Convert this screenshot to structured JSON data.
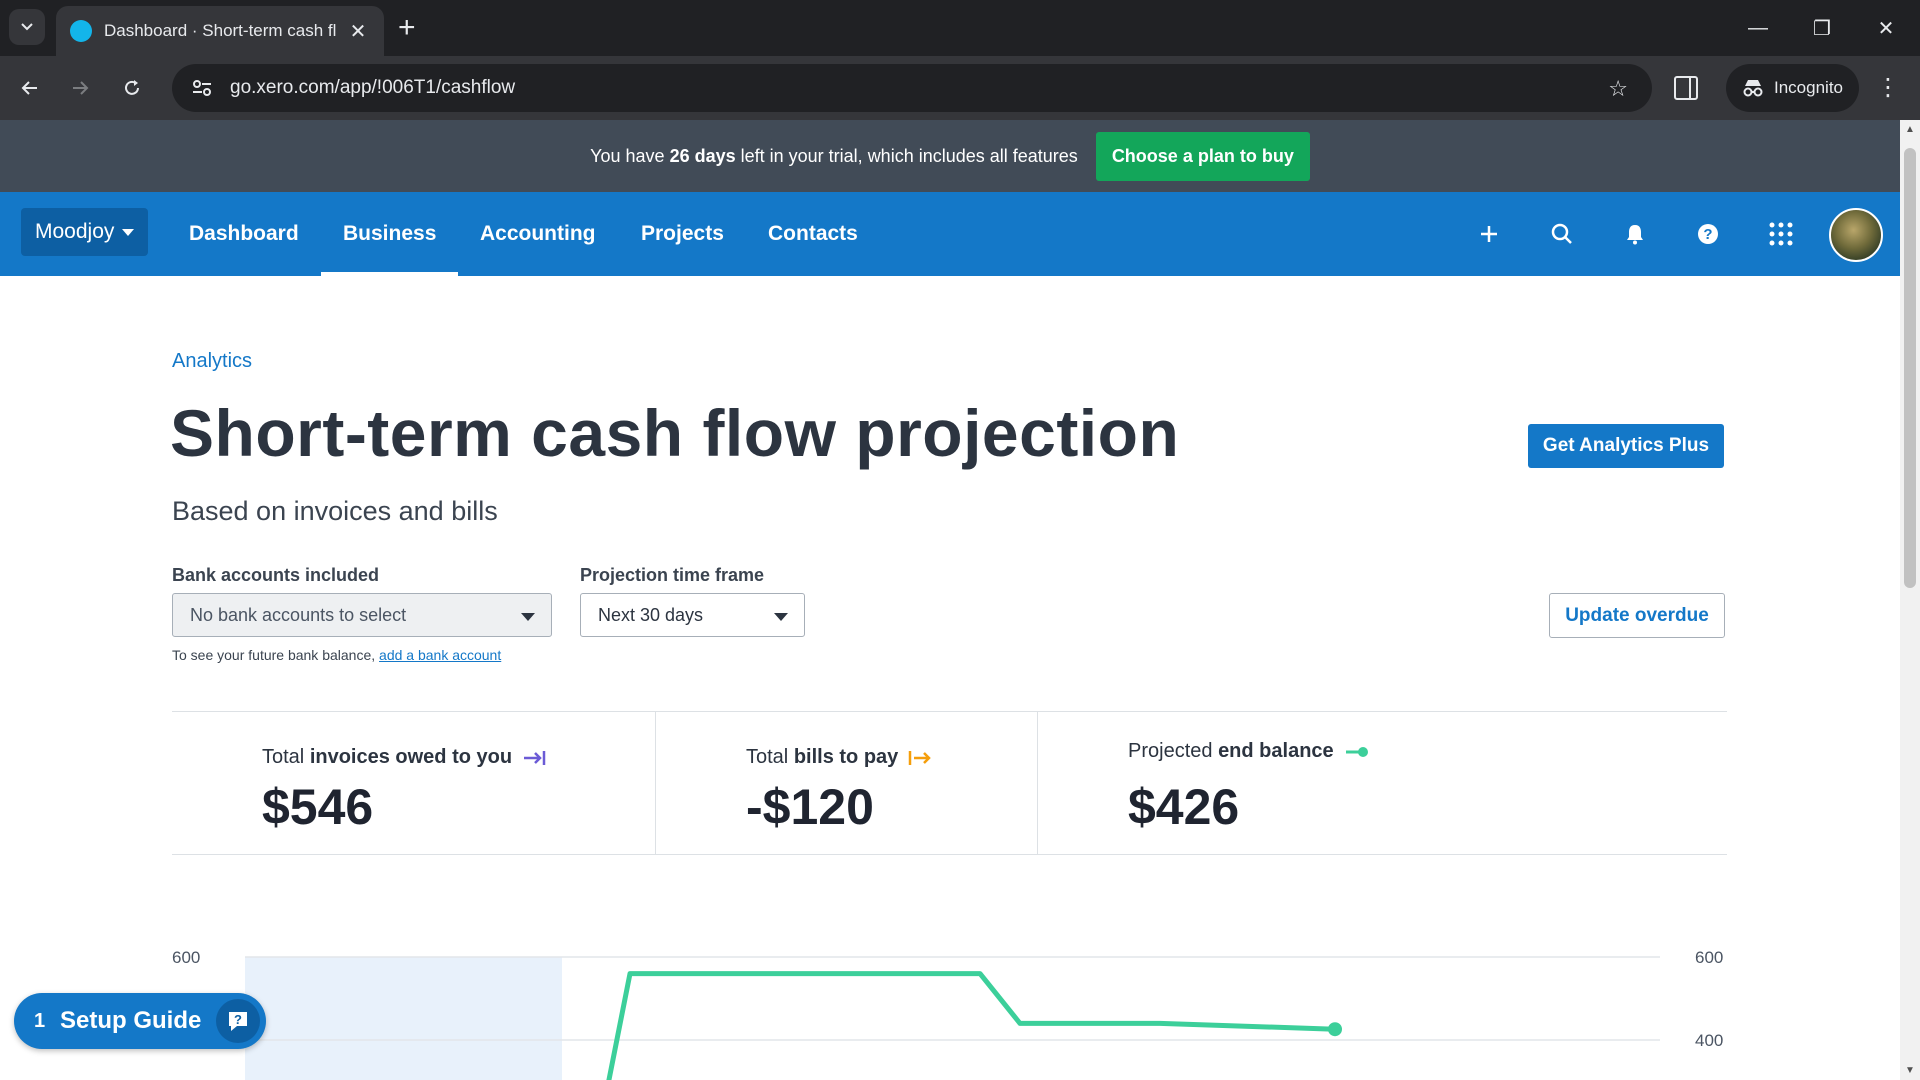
{
  "browser": {
    "tab_title": "Dashboard · Short-term cash fl",
    "url": "go.xero.com/app/!006T1/cashflow",
    "incognito_label": "Incognito",
    "new_tab": "+",
    "close_tab": "✕",
    "minimize": "—",
    "maximize": "❐",
    "close_window": "✕"
  },
  "trial_banner": {
    "text_before": "You have ",
    "days": "26 days",
    "text_after": " left in your trial, which includes all features",
    "cta": "Choose a plan to buy"
  },
  "nav": {
    "org": "Moodjoy",
    "items": [
      "Dashboard",
      "Business",
      "Accounting",
      "Projects",
      "Contacts"
    ],
    "active": "Business"
  },
  "page": {
    "breadcrumb": "Analytics",
    "title": "Short-term cash flow projection",
    "subtitle": "Based on invoices and bills",
    "cta": "Get Analytics Plus"
  },
  "filters": {
    "bank_label": "Bank accounts included",
    "bank_value": "No bank accounts to select",
    "timeframe_label": "Projection time frame",
    "timeframe_value": "Next 30 days",
    "hint_text": "To see your future bank balance, ",
    "hint_link": "add a bank account",
    "update_button": "Update overdue"
  },
  "summary": {
    "invoices": {
      "prefix": "Total ",
      "bold": "invoices owed to you",
      "value": "$546"
    },
    "bills": {
      "prefix": "Total ",
      "bold": "bills to pay",
      "value": "-$120"
    },
    "balance": {
      "prefix": "Projected ",
      "bold": "end balance",
      "value": "$426"
    }
  },
  "chart_data": {
    "type": "line",
    "y_ticks_left": [
      "600"
    ],
    "y_ticks_right": [
      "600",
      "400"
    ],
    "ylim": [
      300,
      600
    ],
    "series": [
      {
        "values": [
          280,
          560,
          560,
          560,
          440,
          440,
          426
        ]
      }
    ],
    "colors": {
      "line": "#3ccf9a",
      "highlight": "#e8f1fb",
      "grid": "#e2e6ea"
    }
  },
  "setup_guide": {
    "count": "1",
    "label": "Setup Guide"
  },
  "colors": {
    "brand": "#1478c8",
    "banner": "#414b57",
    "cta_green": "#13a65a",
    "invoice_arrow": "#6b5bd6",
    "bill_arrow": "#f59e0b",
    "balance_dot": "#3ccf9a"
  }
}
